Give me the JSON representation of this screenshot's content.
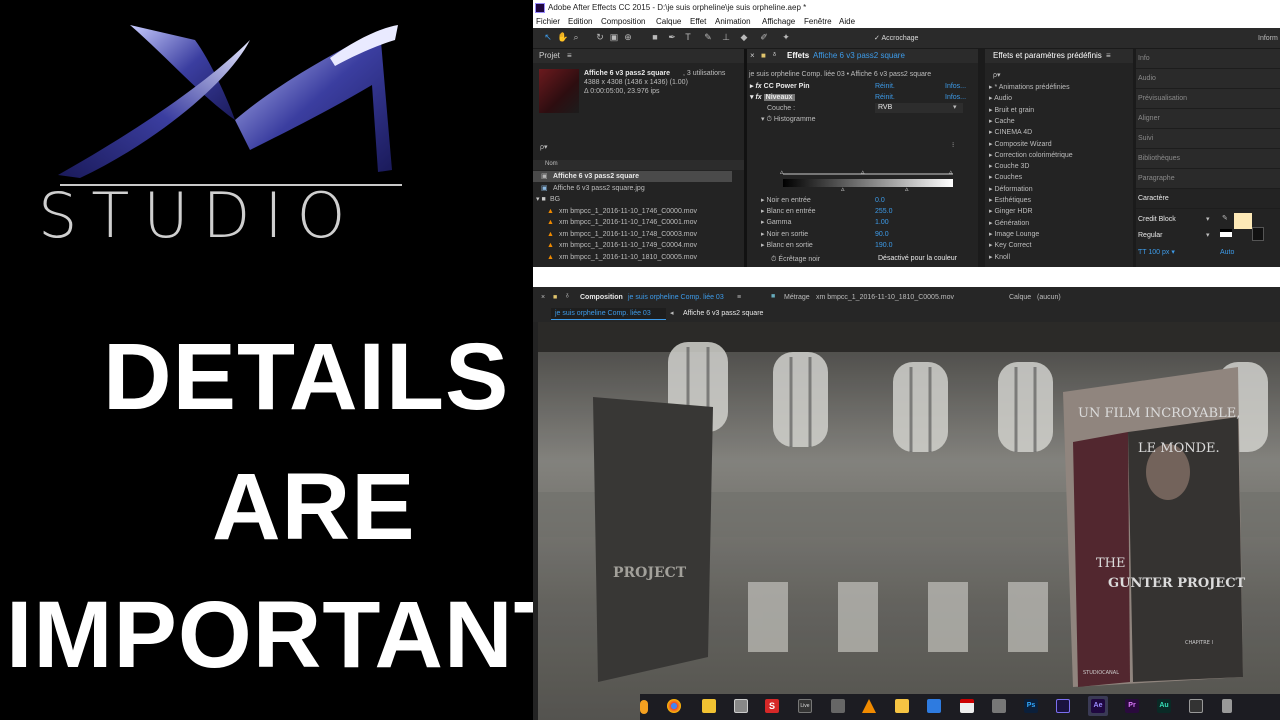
{
  "branding": {
    "logo_text": "STUDIO",
    "headline": [
      "DETAILS",
      "ARE",
      "IMPORTANT"
    ]
  },
  "window": {
    "title": "Adobe After Effects CC 2015 - D:\\je suis orpheline\\je suis orpheline.aep *",
    "menu": [
      "Fichier",
      "Edition",
      "Composition",
      "Calque",
      "Effet",
      "Animation",
      "Affichage",
      "Fenêtre",
      "Aide"
    ]
  },
  "toolbar": {
    "snap_label": "Accrochage",
    "workspace_label": "Inform"
  },
  "project": {
    "header": "Projet",
    "asset_name": "Affiche 6 v3 pass2 square",
    "asset_usage": ", 3 utilisations",
    "asset_dims": "4388 x 4308  (1436 x 1436) (1.00)",
    "asset_time": "Δ 0:00:05:00, 23.976 ips",
    "search_placeholder": "ρ▾",
    "column_name": "Nom",
    "items": [
      {
        "name": "Affiche 6 v3 pass2 square",
        "selected": true,
        "icon": "comp-icon"
      },
      {
        "name": "Affiche 6 v3 pass2 square.jpg",
        "selected": false,
        "icon": "image-icon"
      },
      {
        "name": "BG",
        "selected": false,
        "icon": "folder-icon"
      },
      {
        "name": "xm bmpcc_1_2016-11-10_1746_C0000.mov",
        "selected": false,
        "icon": "vlc-icon"
      },
      {
        "name": "xm bmpcc_1_2016-11-10_1746_C0001.mov",
        "selected": false,
        "icon": "vlc-icon"
      },
      {
        "name": "xm bmpcc_1_2016-11-10_1748_C0003.mov",
        "selected": false,
        "icon": "vlc-icon"
      },
      {
        "name": "xm bmpcc_1_2016-11-10_1749_C0004.mov",
        "selected": false,
        "icon": "vlc-icon"
      },
      {
        "name": "xm bmpcc_1_2016-11-10_1810_C0005.mov",
        "selected": false,
        "icon": "vlc-icon"
      }
    ]
  },
  "effects": {
    "header": "Effets",
    "header_layer": "Affiche 6 v3 pass2 square",
    "breadcrumb": "je suis orpheline Comp. liée 03 • Affiche 6 v3 pass2 square",
    "effect1": {
      "name": "CC Power Pin",
      "reset": "Réinit.",
      "info": "Infos..."
    },
    "effect2": {
      "name": "Niveaux",
      "reset": "Réinit.",
      "info": "Infos..."
    },
    "channel_label": "Couche :",
    "channel_value": "RVB",
    "histogram_label": "Histogramme",
    "params": [
      {
        "label": "Noir en entrée",
        "value": "0.0"
      },
      {
        "label": "Blanc en entrée",
        "value": "255.0"
      },
      {
        "label": "Gamma",
        "value": "1.00"
      },
      {
        "label": "Noir en sortie",
        "value": "90.0"
      },
      {
        "label": "Blanc en sortie",
        "value": "190.0"
      }
    ],
    "clip_label": "Écrêtage noir",
    "clip_value": "Désactivé pour la couleur"
  },
  "presets": {
    "header": "Effets et paramètres prédéfinis",
    "search": "ρ▾",
    "items": [
      "* Animations prédéfinies",
      "Audio",
      "Bruit et grain",
      "Cache",
      "CINEMA 4D",
      "Composite Wizard",
      "Correction colorimétrique",
      "Couche 3D",
      "Couches",
      "Déformation",
      "Esthétiques",
      "Ginger HDR",
      "Génération",
      "Image Lounge",
      "Key Correct",
      "Knoll"
    ]
  },
  "side_panels": {
    "items": [
      "Info",
      "Audio",
      "Prévisualisation",
      "Aligner",
      "Suivi",
      "Bibliothèques",
      "Paragraphe",
      "Caractère"
    ],
    "font_name": "Credit Block",
    "font_style": "Regular",
    "font_size": "100 px",
    "leading": "Auto"
  },
  "composition": {
    "header": "Composition",
    "comp_name": "je suis orpheline Comp. liée 03",
    "footage_label": "Métrage",
    "footage_name": "xm bmpcc_1_2016-11-10_1810_C0005.mov",
    "layer_label": "Calque",
    "layer_value": "(aucun)",
    "tab_active": "je suis orpheline Comp. liée 03",
    "tab_breadcrumb": "Affiche 6 v3 pass2 square",
    "poster_text": {
      "line1": "UN FILM INCROYABLE,",
      "line2": "LE MONDE.",
      "title1": "THE",
      "title2": "GUNTER PROJECT",
      "small": "CHAPITRE I",
      "studio": "STUDIOCANAL",
      "left_poster": "PROJECT"
    }
  },
  "taskbar": {
    "icons": [
      "chrome-icon",
      "folder-icon",
      "vpn-icon",
      "s-app-icon",
      "live-icon",
      "tool-icon",
      "vlc-icon",
      "media-icon",
      "browser-icon",
      "acrobat-icon",
      "edit-icon",
      "photoshop-icon",
      "media-encoder-icon",
      "after-effects-icon",
      "premiere-icon",
      "audition-icon",
      "app-icon",
      "trash-icon"
    ],
    "labels": {
      "photoshop": "Ps",
      "after_effects": "Ae",
      "premiere": "Pr",
      "audition": "Au",
      "live": "Live",
      "s_app": "S"
    }
  },
  "colors": {
    "ae_blue": "#3d9be9",
    "panel_bg": "#232323",
    "logo_purple": "#3c3f9a"
  }
}
